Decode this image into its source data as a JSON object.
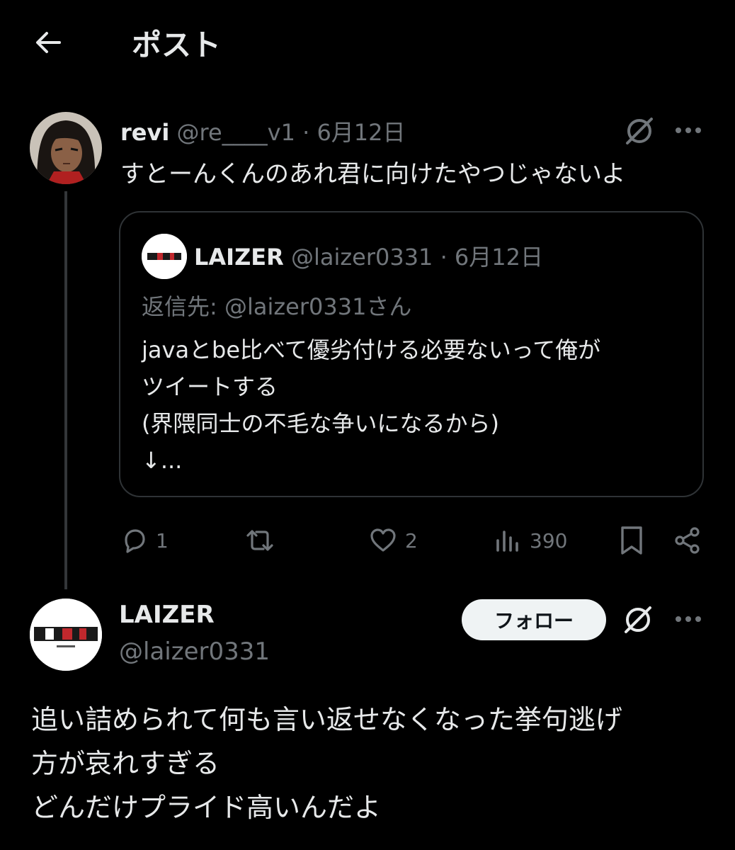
{
  "header": {
    "title": "ポスト",
    "back_icon": "arrow-left-icon"
  },
  "parent_tweet": {
    "display_name": "revi",
    "handle": "@re____v1",
    "separator": "·",
    "date": "6月12日",
    "text": "すとーんくんのあれ君に向けたやつじゃないよ",
    "quote": {
      "display_name": "LAIZER",
      "handle": "@laizer0331",
      "separator": "·",
      "date": "6月12日",
      "reply_to": "返信先: @laizer0331さん",
      "body_lines": [
        "javaとbe比べて優劣付ける必要ないって俺が",
        "ツイートする",
        "(界隈同士の不毛な争いになるから)",
        "↓..."
      ]
    },
    "actions": {
      "replies": "1",
      "reposts": "",
      "likes": "2",
      "views": "390"
    }
  },
  "main_tweet": {
    "display_name": "LAIZER",
    "handle": "@laizer0331",
    "follow_label": "フォロー",
    "text_lines": [
      "追い詰められて何も言い返せなくなった挙句逃げ",
      "方が哀れすぎる",
      "どんだけプライド高いんだよ"
    ]
  },
  "colors": {
    "background": "#000000",
    "text": "#e7e9ea",
    "muted": "#71767b",
    "border": "#2f3336",
    "follow_bg": "#eff3f4"
  }
}
